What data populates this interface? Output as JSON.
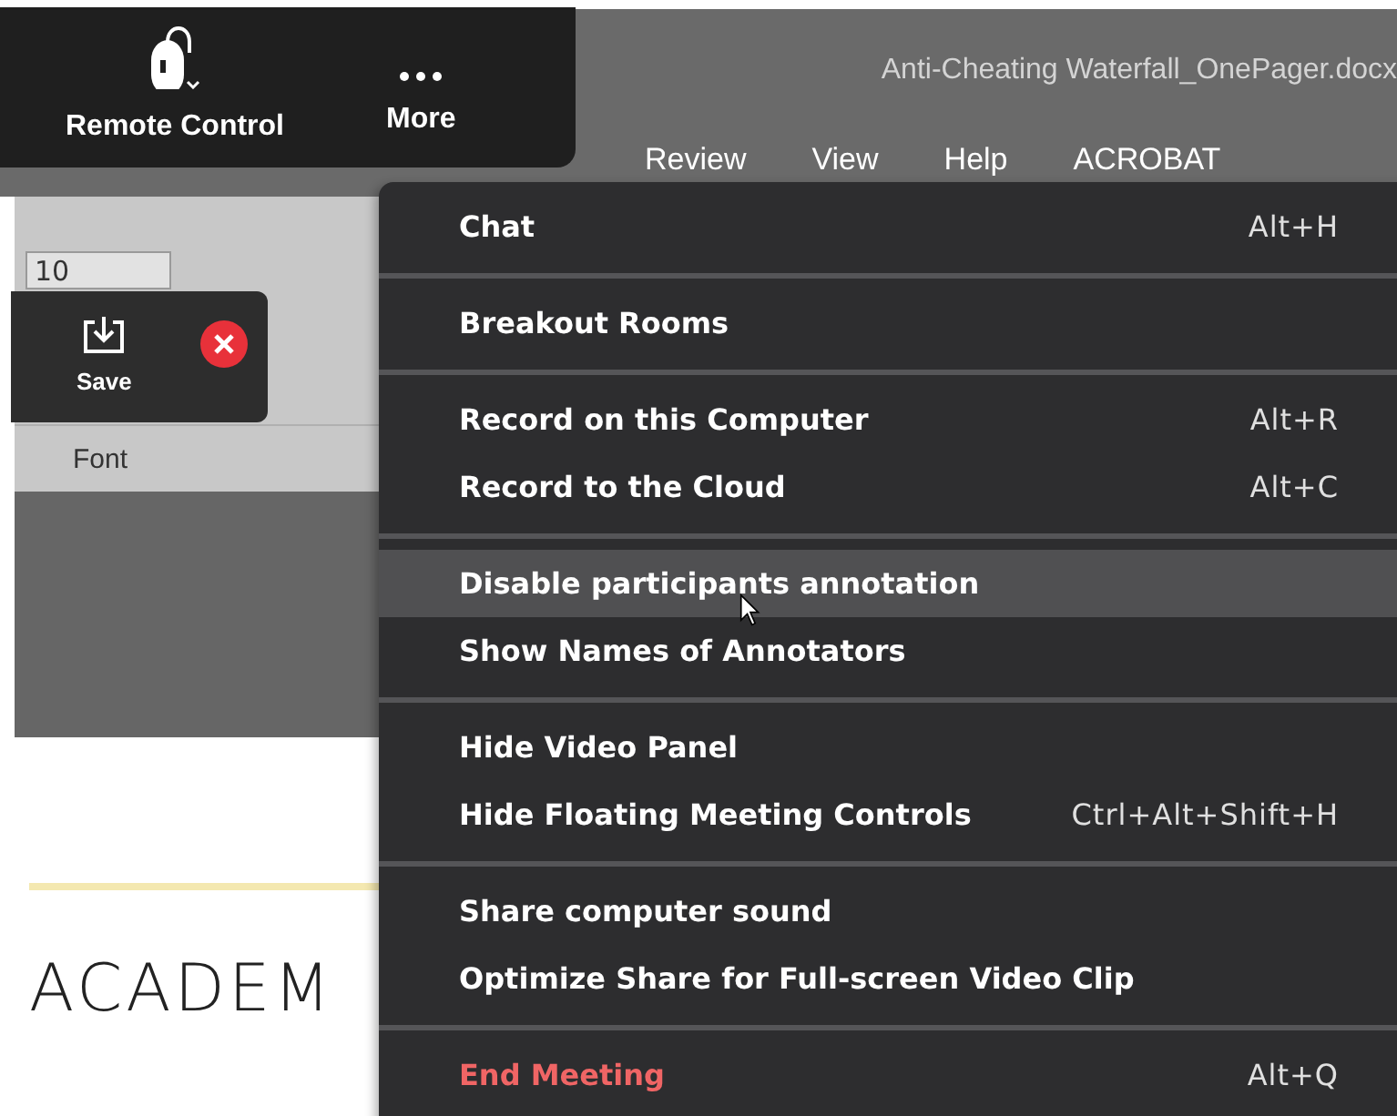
{
  "meeting_toolbar": {
    "buttons": [
      {
        "label": "Remote Control",
        "kind": "mouse"
      },
      {
        "label": "More",
        "kind": "dots"
      }
    ]
  },
  "document_window": {
    "title": "Anti-Cheating Waterfall_OnePager.docx",
    "tabs": [
      "Review",
      "View",
      "Help",
      "ACROBAT"
    ],
    "font_size": "10",
    "group_label": "Font",
    "heading": "ACADEM"
  },
  "annotation_panel": {
    "save_label": "Save"
  },
  "menu": {
    "groups": [
      [
        {
          "label": "Chat",
          "shortcut": "Alt+H",
          "selected": false,
          "kind": "normal"
        }
      ],
      [
        {
          "label": "Breakout Rooms",
          "selected": false,
          "kind": "normal"
        }
      ],
      [
        {
          "label": "Record on this Computer",
          "shortcut": "Alt+R",
          "selected": false,
          "kind": "normal"
        },
        {
          "label": "Record to the Cloud",
          "shortcut": "Alt+C",
          "selected": false,
          "kind": "normal"
        }
      ],
      [
        {
          "label": "Disable participants annotation",
          "selected": true,
          "kind": "normal"
        },
        {
          "label": "Show Names of Annotators",
          "selected": false,
          "kind": "normal"
        }
      ],
      [
        {
          "label": "Hide Video Panel",
          "selected": false,
          "kind": "normal"
        },
        {
          "label": "Hide Floating Meeting Controls",
          "shortcut": "Ctrl+Alt+Shift+H",
          "selected": false,
          "kind": "normal"
        }
      ],
      [
        {
          "label": "Share computer sound",
          "selected": false,
          "kind": "normal"
        },
        {
          "label": "Optimize Share for Full-screen Video Clip",
          "selected": false,
          "kind": "normal"
        }
      ],
      [
        {
          "label": "End Meeting",
          "shortcut": "Alt+Q",
          "selected": false,
          "kind": "danger"
        }
      ]
    ]
  }
}
